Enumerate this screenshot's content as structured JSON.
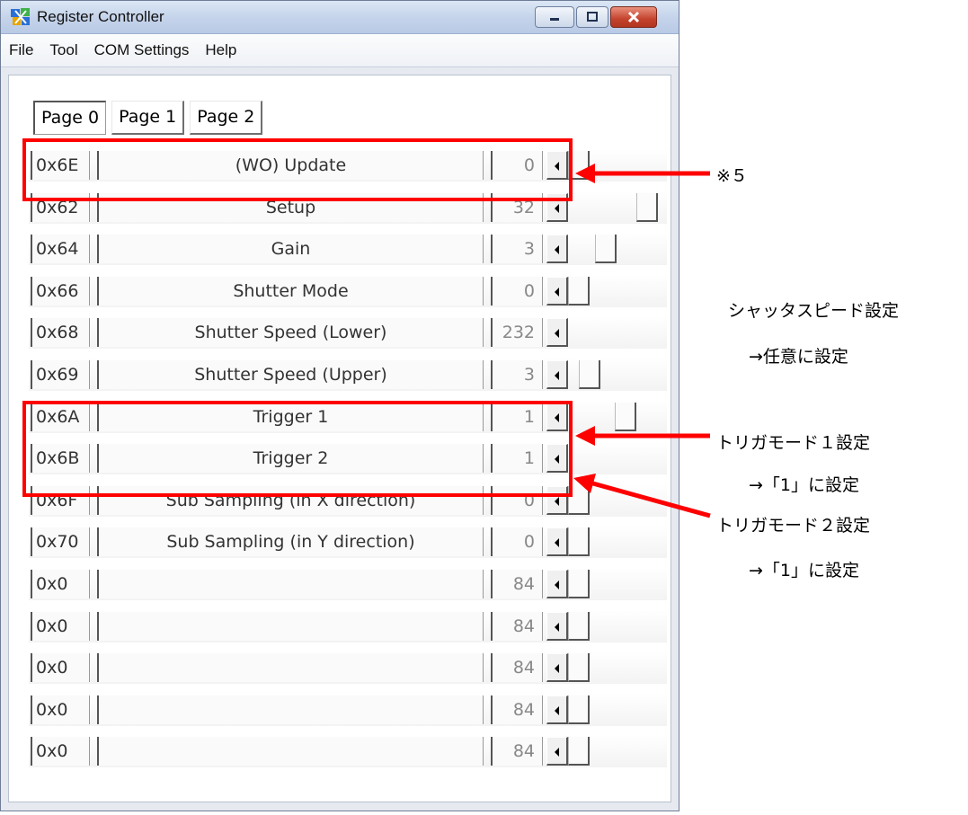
{
  "window": {
    "title": "Register Controller",
    "buttons": {
      "minimize": "minimize",
      "maximize": "maximize",
      "close": "close"
    }
  },
  "menu": [
    "File",
    "Tool",
    "COM Settings",
    "Help"
  ],
  "tabs": [
    {
      "label": "Page 0",
      "active": true
    },
    {
      "label": "Page 1",
      "active": false
    },
    {
      "label": "Page 2",
      "active": false
    }
  ],
  "registers": [
    {
      "addr": "0x6E",
      "name": "(WO) Update",
      "value": "0"
    },
    {
      "addr": "0x62",
      "name": "Setup",
      "value": "32"
    },
    {
      "addr": "0x64",
      "name": "Gain",
      "value": "3"
    },
    {
      "addr": "0x66",
      "name": "Shutter Mode",
      "value": "0"
    },
    {
      "addr": "0x68",
      "name": "Shutter Speed (Lower)",
      "value": "232"
    },
    {
      "addr": "0x69",
      "name": "Shutter Speed (Upper)",
      "value": "3"
    },
    {
      "addr": "0x6A",
      "name": "Trigger 1",
      "value": "1"
    },
    {
      "addr": "0x6B",
      "name": "Trigger 2",
      "value": "1"
    },
    {
      "addr": "0x6F",
      "name": "Sub Sampling (in X direction)",
      "value": "0"
    },
    {
      "addr": "0x70",
      "name": "Sub Sampling (in Y direction)",
      "value": "0"
    },
    {
      "addr": "0x0",
      "name": "",
      "value": "84"
    },
    {
      "addr": "0x0",
      "name": "",
      "value": "84"
    },
    {
      "addr": "0x0",
      "name": "",
      "value": "84"
    },
    {
      "addr": "0x0",
      "name": "",
      "value": "84"
    },
    {
      "addr": "0x0",
      "name": "",
      "value": "84"
    }
  ],
  "annotations": {
    "note5": "※５",
    "shutter_title": "シャッタスピード設定",
    "shutter_sub": "→任意に設定",
    "trigger1_title": "トリガモード１設定",
    "trigger1_sub": "→「1」に設定",
    "trigger2_title": "トリガモード２設定",
    "trigger2_sub": "→「1」に設定"
  },
  "colors": {
    "highlight": "#ff0000",
    "titlebar": "#c4d3ea"
  }
}
